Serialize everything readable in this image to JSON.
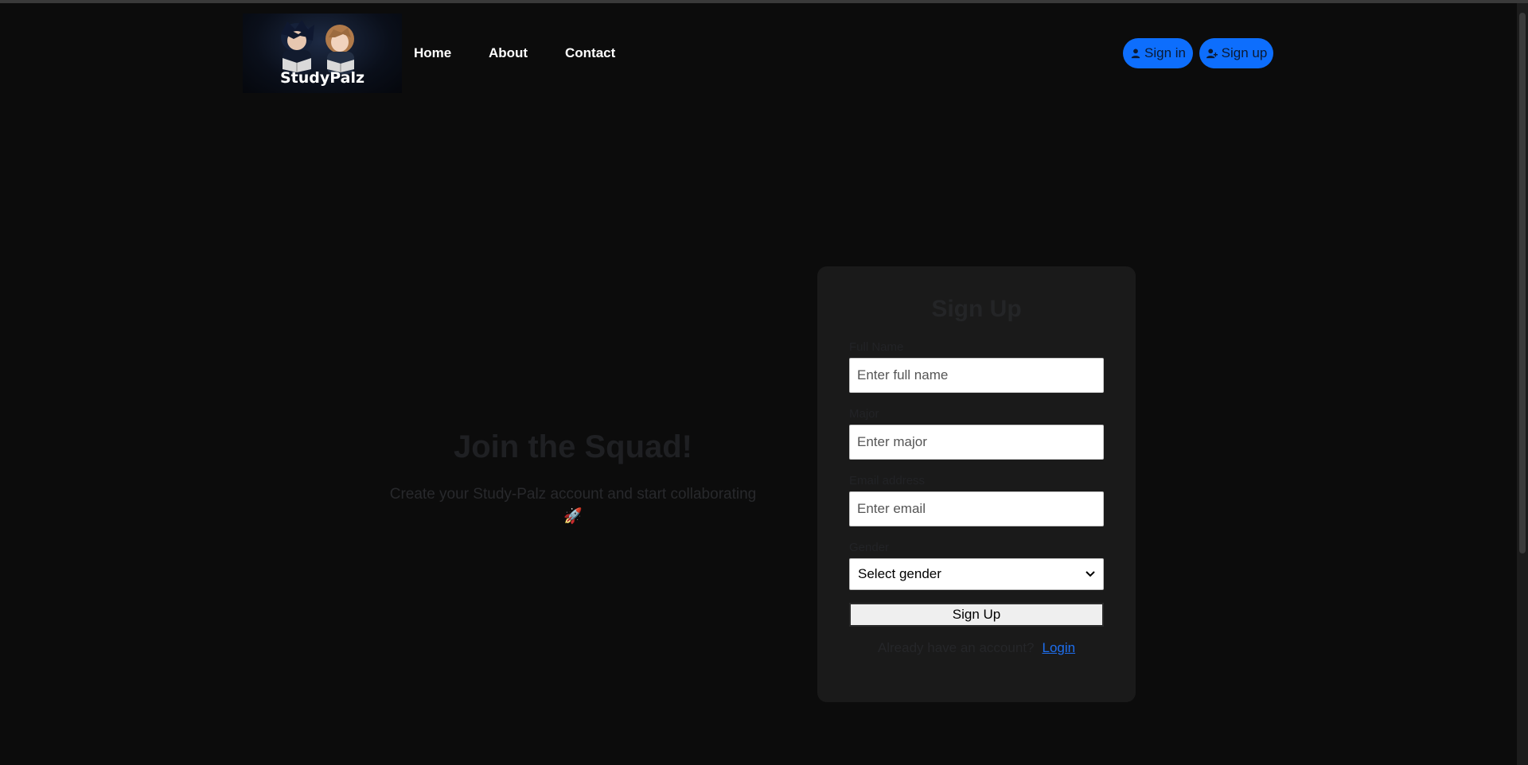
{
  "brand": {
    "logo_text": "StudyPalz"
  },
  "nav": {
    "links": [
      "Home",
      "About",
      "Contact"
    ]
  },
  "auth": {
    "signin_label": "Sign in",
    "signup_label": "Sign up",
    "accent": "#0d6efd"
  },
  "hero": {
    "title": "Join the Squad!",
    "subtitle": "Create your Study-Palz account and start collaborating",
    "emoji": "🚀"
  },
  "form": {
    "title": "Sign Up",
    "fields": [
      {
        "label": "Full Name",
        "placeholder": "Enter full name"
      },
      {
        "label": "Major",
        "placeholder": "Enter major"
      },
      {
        "label": "Email address",
        "placeholder": "Enter email"
      }
    ],
    "gender": {
      "label": "Gender",
      "selected": "Select gender"
    },
    "submit_label": "Sign Up",
    "footer_text": "Already have an account?",
    "login_label": "Login",
    "link_color": "#1e6ff0"
  },
  "colors": {
    "background": "#0c0c0c",
    "card": "#1a1a1a"
  }
}
